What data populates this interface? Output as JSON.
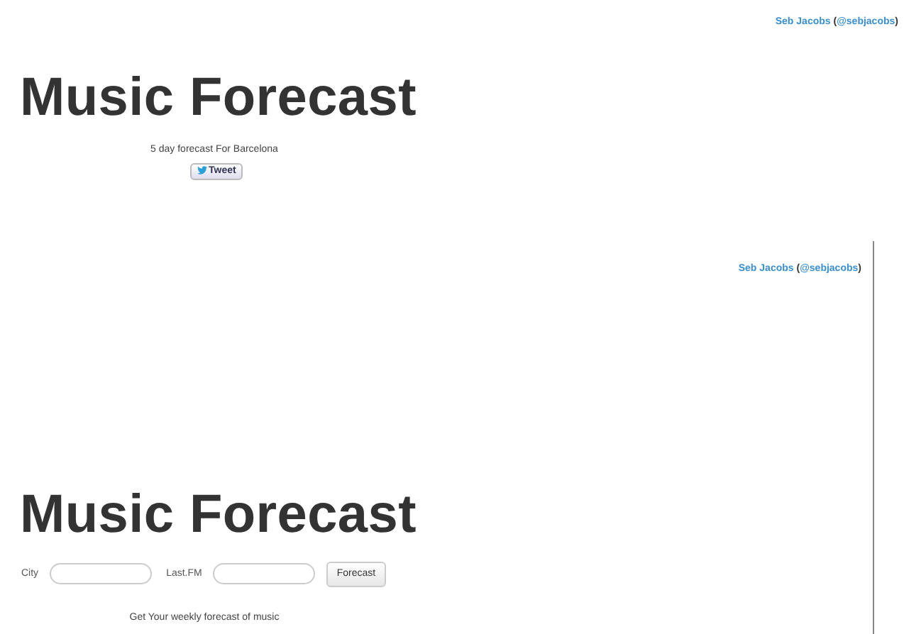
{
  "panels": [
    {
      "credit": {
        "name": "Seb Jacobs",
        "open": "(",
        "handle": "@sebjacobs",
        "close": ")"
      },
      "title": "Music Forecast",
      "subtitle": "5 day forecast For Barcelona",
      "tweet_button": "Tweet"
    },
    {
      "credit": {
        "name": "Seb Jacobs",
        "open": "(",
        "handle": "@sebjacobs",
        "close": ")"
      },
      "title": "Music Forecast",
      "form": {
        "fields": [
          {
            "label": "City"
          },
          {
            "label": "Last.FM"
          }
        ],
        "button": "Forecast"
      },
      "tagline": "Get Your weekly forecast of music"
    }
  ]
}
